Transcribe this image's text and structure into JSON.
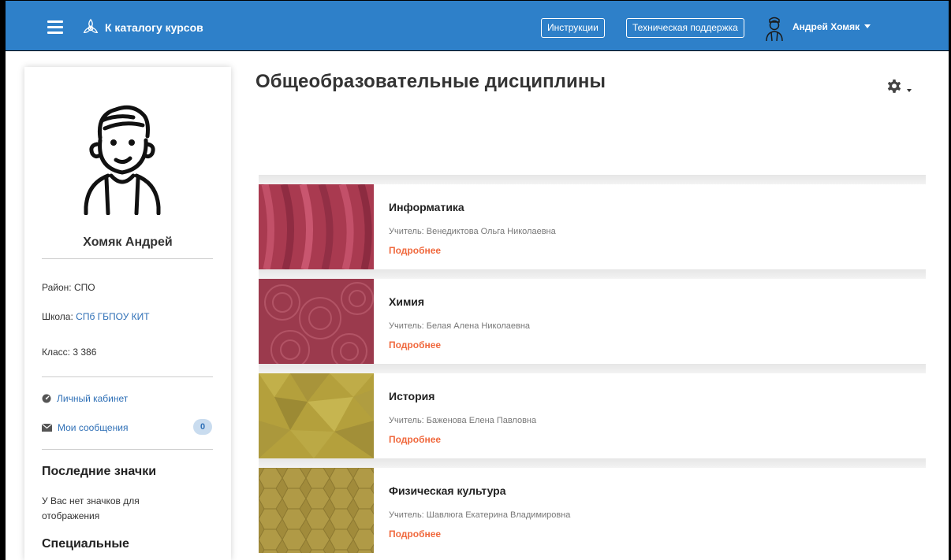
{
  "header": {
    "brand_label": "К каталогу курсов",
    "instructions_label": "Инструкции",
    "support_label": "Техническая поддержка",
    "user_name": "Андрей Хомяк",
    "bg_color": "#2e80c9"
  },
  "sidebar": {
    "name": "Хомяк Андрей",
    "district_label": "Район:",
    "district_value": "СПО",
    "school_label": "Школа:",
    "school_value": "СПб ГБПОУ КИТ",
    "class_label": "Класс:",
    "class_value": "3 386",
    "nav": {
      "cabinet": "Личный кабинет",
      "messages": "Мои сообщения",
      "messages_count": "0"
    },
    "badges_title": "Последние значки",
    "badges_empty": "У Вас нет значков для отображения",
    "special_title": "Специальные"
  },
  "main": {
    "title": "Общеобразовательные дисциплины",
    "courses": [
      {
        "title": "Информатика",
        "teacher": "Учитель: Венедиктова Ольга Николаевна",
        "more": "Подробнее",
        "color": "#b03a52"
      },
      {
        "title": "Химия",
        "teacher": "Учитель: Белая Алена Николаевна",
        "more": "Подробнее",
        "color": "#9e3a4e"
      },
      {
        "title": "История",
        "teacher": "Учитель: Баженова Елена Павловна",
        "more": "Подробнее",
        "color": "#b5a23c"
      },
      {
        "title": "Физическая культура",
        "teacher": "Учитель: Шавлюга Екатерина Владимировна",
        "more": "Подробнее",
        "color": "#a8923e"
      }
    ]
  },
  "colors": {
    "link": "#2e6fb6",
    "more": "#f0693e"
  }
}
